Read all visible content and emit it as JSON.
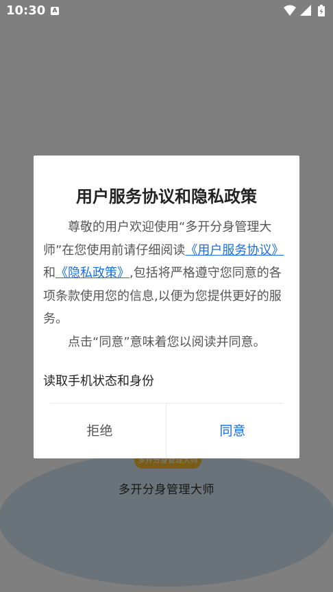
{
  "status_bar": {
    "time": "10:30",
    "notification_icon": "A"
  },
  "background": {
    "badge_text": "多开分身管理大师",
    "app_name": "多开分身管理大师"
  },
  "dialog": {
    "title": "用户服务协议和隐私政策",
    "body_p1_a": "尊敬的用户欢迎使用“多开分身管理大师”在您使用前请仔细阅读",
    "link_user_agreement": "《用户服务协议》",
    "body_p1_and": "和",
    "link_privacy": "《隐私政策》",
    "body_p1_b": ",包括将严格遵守您同意的各项条款使用您的信息,以便为您提供更好的服务。",
    "body_p2": "点击“同意”意味着您以阅读并同意。",
    "permission": "读取手机状态和身份",
    "reject_label": "拒绝",
    "agree_label": "同意"
  },
  "colors": {
    "link": "#1a6ee0",
    "scrim": "rgba(0,0,0,0.5)"
  }
}
